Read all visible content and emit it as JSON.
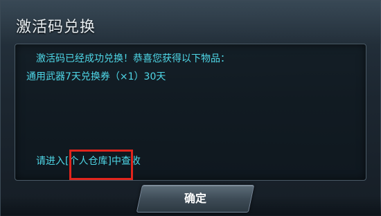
{
  "dialog": {
    "title": "激活码兑换",
    "message_line1": "激活码已经成功兑换！恭喜您获得以下物品：",
    "reward_item": "通用武器7天兑换券（×1）30天",
    "hint_prefix": "请进入",
    "hint_link": "[个人仓库]",
    "hint_suffix": "中查收",
    "confirm_label": "确定"
  },
  "colors": {
    "message_text": "#4fd8e8",
    "highlight_border": "#e0241c",
    "title_text": "#e8eef2"
  }
}
